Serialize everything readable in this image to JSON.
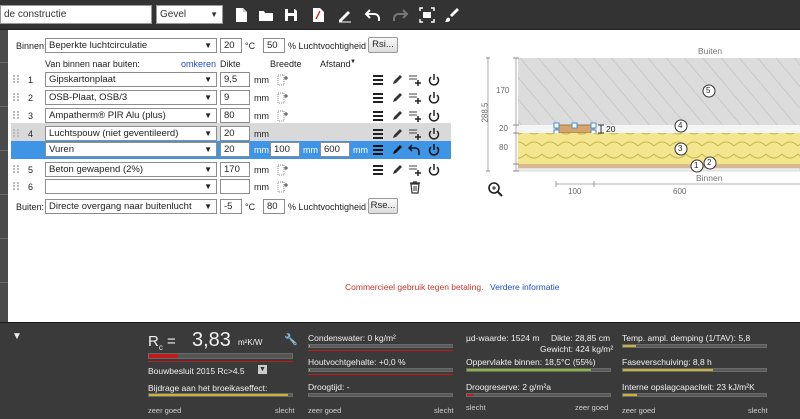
{
  "toolbar": {
    "construction_name": "de constructie",
    "type_value": "Gevel",
    "icons": [
      "new-file-icon",
      "open-folder-icon",
      "save-icon",
      "pdf-icon",
      "signature-icon",
      "undo-icon",
      "redo-icon",
      "fit-screen-icon",
      "brush-icon"
    ]
  },
  "inside": {
    "label": "Binnen:",
    "condition": "Beperkte luchtcirculatie",
    "temp": "20",
    "temp_unit": "°C",
    "humidity": "50",
    "humidity_unit": "% Luchtvochtigheid",
    "rsi_button": "Rsi..."
  },
  "headers": {
    "direction": "Van binnen naar buiten:",
    "reverse": "omkeren",
    "thickness": "Dikte",
    "width": "Breedte",
    "distance": "Afstand"
  },
  "layers": [
    {
      "num": "1",
      "material": "Gipskartonplaat",
      "thickness": "9,5",
      "unit": "mm"
    },
    {
      "num": "2",
      "material": "OSB-Plaat, OSB/3",
      "thickness": "9",
      "unit": "mm"
    },
    {
      "num": "3",
      "material": "Ampatherm® PIR Alu (plus)",
      "thickness": "80",
      "unit": "mm"
    },
    {
      "num": "4",
      "material": "Luchtspouw (niet geventileerd)",
      "thickness": "20",
      "unit": "mm"
    },
    {
      "num": "",
      "material": "Vuren",
      "thickness": "20",
      "unit": "mm",
      "width": "100",
      "width_unit": "mm",
      "distance": "600",
      "distance_unit": "mm"
    },
    {
      "num": "5",
      "material": "Beton gewapend (2%)",
      "thickness": "170",
      "unit": "mm"
    },
    {
      "num": "6",
      "material": "",
      "thickness": "",
      "unit": "mm"
    }
  ],
  "outside": {
    "label": "Buiten:",
    "condition": "Directe overgang naar buitenlucht",
    "temp": "-5",
    "temp_unit": "°C",
    "humidity": "80",
    "humidity_unit": "% Luchtvochtigheid",
    "rse_button": "Rse..."
  },
  "notice": {
    "text": "Commercieel gebruik tegen betaling.",
    "link": "Verdere informatie"
  },
  "diagram": {
    "outside_label": "Buiten",
    "inside_label": "Binnen",
    "dim_total": "288,5",
    "dims": [
      "170",
      "20",
      "80"
    ],
    "stud_thickness": "20",
    "x_dims": [
      "100",
      "600"
    ],
    "layer_markers": [
      "5",
      "4",
      "3",
      "2",
      "1"
    ]
  },
  "results": {
    "rc_label": "R",
    "rc_sub": "c",
    "rc_value": "3,83",
    "rc_unit": "m²K/W",
    "rc_requirement": "Bouwbesluit 2015 Rc>4.5",
    "greenhouse": "Bijdrage aan het broeikaseffect:",
    "condensate": "Condenswater: 0 kg/m²",
    "wood_moisture": "Houtvochtgehalte: +0,0 %",
    "drying_time": "Droogtijd: -",
    "sd_value": "µd-waarde: 1524 m",
    "thickness": "Dikte: 28,85 cm",
    "weight": "Gewicht: 424 kg/m²",
    "surface_temp": "Oppervlakte binnen: 18,5°C (55%)",
    "drying_reserve": "Droogreserve: 2 g/m²a",
    "temp_damping": "Temp. ampl. demping (1/TAV): 5,8",
    "phase_shift": "Faseverschuiving: 8,8 h",
    "heat_capacity": "Interne opslagcapaciteit: 23 kJ/m²K",
    "good": "zeer goed",
    "bad": "slecht",
    "levels": {
      "rc": 0.2,
      "greenhouse": 0.97,
      "condensate": 0.01,
      "wood_moisture": 0.01,
      "drying_time": 0.0,
      "surface_temp": 0.87,
      "drying_reserve": 0.04,
      "temp_damping": 0.09,
      "phase_shift": 0.63,
      "heat_capacity": 0.1
    },
    "colors": {
      "green": "#88b83a",
      "yellow": "#c8b23a",
      "red": "#c01b1b",
      "blue": "#3d8fe0"
    }
  }
}
